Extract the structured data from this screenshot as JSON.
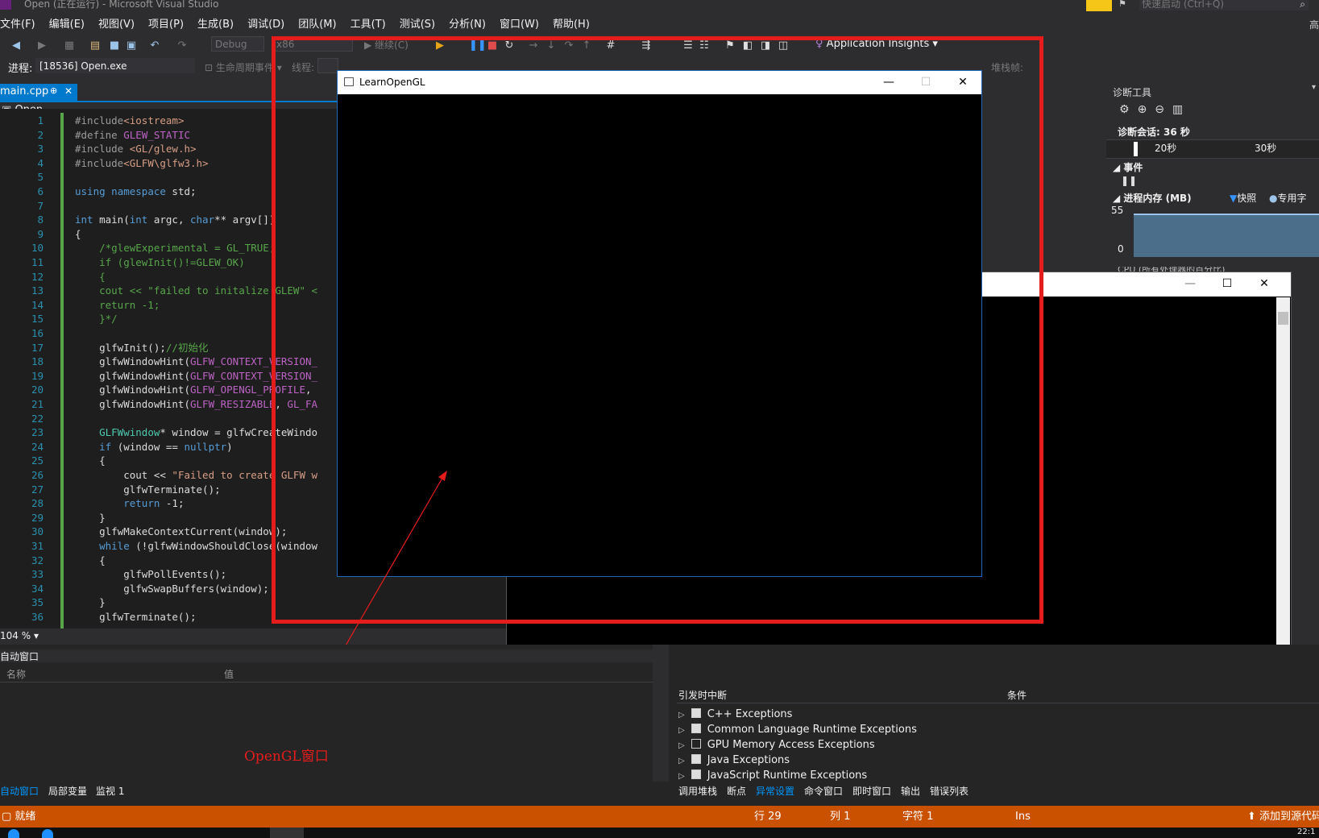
{
  "app": {
    "title": "Open (正在运行) - Microsoft Visual Studio",
    "quick_launch_placeholder": "快速启动 (Ctrl+Q)",
    "user_initial": "高"
  },
  "menu": [
    "文件(F)",
    "编辑(E)",
    "视图(V)",
    "项目(P)",
    "生成(B)",
    "调试(D)",
    "团队(M)",
    "工具(T)",
    "测试(S)",
    "分析(N)",
    "窗口(W)",
    "帮助(H)"
  ],
  "toolbar": {
    "config": "Debug",
    "platform": "x86",
    "continue_label": "继续(C)",
    "app_insights": "Application Insights"
  },
  "debug_bar": {
    "process_label": "进程:",
    "process_value": "[18536] Open.exe",
    "lifecycle_label": "生命周期事件",
    "thread_label": "线程:",
    "stack_label": "堆栈帧:"
  },
  "document_tab": {
    "name": "main.cpp",
    "pin": "⊕",
    "close": "✕",
    "scope": "Open"
  },
  "code_lines": [
    "#include<iostream>",
    "#define GLEW_STATIC",
    "#include <GL/glew.h>",
    "#include<GLFW\\glfw3.h>",
    "",
    "using namespace std;",
    "",
    "int main(int argc, char** argv[])",
    "{",
    "    /*glewExperimental = GL_TRUE;",
    "    if (glewInit()!=GLEW_OK)",
    "    {",
    "    cout << \"failed to initalize GLEW\" <",
    "    return -1;",
    "    }*/",
    "",
    "    glfwInit();//初始化",
    "    glfwWindowHint(GLFW_CONTEXT_VERSION_",
    "    glfwWindowHint(GLFW_CONTEXT_VERSION_",
    "    glfwWindowHint(GLFW_OPENGL_PROFILE,",
    "    glfwWindowHint(GLFW_RESIZABLE, GL_FA",
    "",
    "    GLFWwindow* window = glfwCreateWindo",
    "    if (window == nullptr)",
    "    {",
    "        cout << \"Failed to create GLFW w",
    "        glfwTerminate();",
    "        return -1;",
    "    }",
    "    glfwMakeContextCurrent(window);",
    "    while (!glfwWindowShouldClose(window",
    "    {",
    "        glfwPollEvents();",
    "        glfwSwapBuffers(window);",
    "    }",
    "    glfwTerminate();"
  ],
  "zoom": "104 %",
  "gl_window": {
    "title": "LearnOpenGL",
    "min": "—",
    "max": "☐",
    "close": "✕"
  },
  "annotation": "OpenGL窗口",
  "diagnostics": {
    "title": "诊断工具",
    "session": "诊断会话: 36 秒",
    "tick_20": "20秒",
    "tick_30": "30秒",
    "events_label": "事件",
    "memory_label": "进程内存 (MB)",
    "snapshot_label": "快照",
    "private_label": "专用字",
    "mem_max": "55",
    "mem_min": "0",
    "cpu_label": "CPU (所有处理器的百分比)"
  },
  "autos": {
    "title": "自动窗口",
    "col_name": "名称",
    "col_value": "值"
  },
  "exceptions": {
    "col_break": "引发时中断",
    "col_condition": "条件",
    "items": [
      {
        "label": "C++ Exceptions",
        "checked": true
      },
      {
        "label": "Common Language Runtime Exceptions",
        "checked": true
      },
      {
        "label": "GPU Memory Access Exceptions",
        "checked": false
      },
      {
        "label": "Java Exceptions",
        "checked": true
      },
      {
        "label": "JavaScript Runtime Exceptions",
        "checked": true
      }
    ]
  },
  "bottom_tabs_left": [
    "自动窗口",
    "局部变量",
    "监视 1"
  ],
  "bottom_tabs_right": [
    "调用堆栈",
    "断点",
    "异常设置",
    "命令窗口",
    "即时窗口",
    "输出",
    "错误列表"
  ],
  "status": {
    "ready": "就绪",
    "row": "行 29",
    "col": "列 1",
    "char": "字符 1",
    "ins": "Ins",
    "source_control": "添加到源代码管理",
    "clock": "22:1"
  },
  "colors": {
    "status_bar": "#ca5100",
    "highlight_box": "#e51c1c",
    "editor_bg": "#1e1e1e"
  }
}
